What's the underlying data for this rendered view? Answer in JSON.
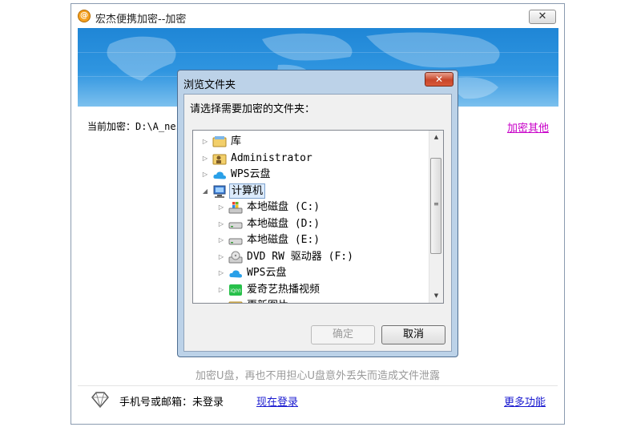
{
  "main_window": {
    "title": "宏杰便携加密--加密",
    "close_glyph": "✕",
    "app_icon_glyph": "@",
    "current_label": "当前加密：D:\\A_nes",
    "encrypt_other_link": "加密其他",
    "slogan": "加密U盘，再也不用担心U盘意外丢失而造成文件泄露",
    "account_label": "手机号或邮箱：未登录",
    "login_link": "现在登录",
    "more_link": "更多功能"
  },
  "dialog": {
    "title": "浏览文件夹",
    "close_glyph": "✕",
    "prompt": "请选择需要加密的文件夹：",
    "ok_label": "确定",
    "cancel_label": "取消",
    "tree": [
      {
        "label": "库",
        "icon": "library-icon",
        "expanded": false,
        "selected": false
      },
      {
        "label": "Administrator",
        "icon": "user-folder-icon",
        "expanded": false,
        "selected": false
      },
      {
        "label": "WPS云盘",
        "icon": "cloud-icon",
        "expanded": false,
        "selected": false
      },
      {
        "label": "计算机",
        "icon": "computer-icon",
        "expanded": true,
        "selected": true
      },
      {
        "label": "本地磁盘 (C:)",
        "icon": "system-drive-icon",
        "expanded": false,
        "selected": false
      },
      {
        "label": "本地磁盘 (D:)",
        "icon": "drive-icon",
        "expanded": false,
        "selected": false
      },
      {
        "label": "本地磁盘 (E:)",
        "icon": "drive-icon",
        "expanded": false,
        "selected": false
      },
      {
        "label": "DVD RW 驱动器 (F:)",
        "icon": "dvd-drive-icon",
        "expanded": false,
        "selected": false
      },
      {
        "label": "WPS云盘",
        "icon": "cloud-icon",
        "expanded": false,
        "selected": false
      },
      {
        "label": "爱奇艺热播视频",
        "icon": "iqiyi-icon",
        "expanded": false,
        "selected": false
      },
      {
        "label": "更新图片",
        "icon": "folder-icon",
        "expanded": false,
        "selected": false
      }
    ]
  },
  "colors": {
    "banner": "#2f95e0",
    "link_blue": "#1a1ad0",
    "link_magenta": "#c800c8",
    "selection": "#dcebfc"
  }
}
